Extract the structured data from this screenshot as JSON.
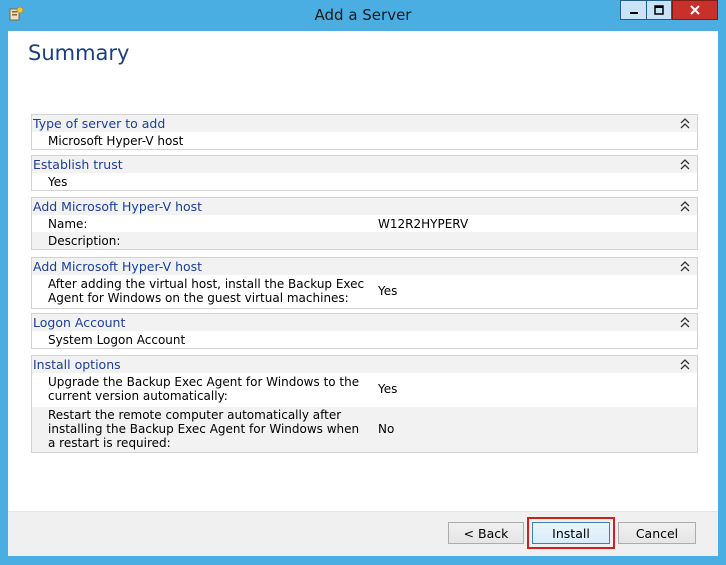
{
  "window": {
    "title": "Add a Server"
  },
  "page": {
    "heading": "Summary"
  },
  "sections": [
    {
      "title": "Type of server to add",
      "rows": [
        {
          "key": "Microsoft Hyper-V host",
          "value": ""
        }
      ]
    },
    {
      "title": "Establish trust",
      "rows": [
        {
          "key": "Yes",
          "value": ""
        }
      ]
    },
    {
      "title": "Add Microsoft Hyper-V host",
      "rows": [
        {
          "key": "Name:",
          "value": "W12R2HYPERV"
        },
        {
          "key": "Description:",
          "value": ""
        }
      ]
    },
    {
      "title": "Add Microsoft Hyper-V host",
      "rows": [
        {
          "key_lines": [
            "After adding the virtual host, install the Backup Exec",
            "Agent for Windows on the guest virtual machines:"
          ],
          "value": "Yes"
        }
      ]
    },
    {
      "title": "Logon Account",
      "rows": [
        {
          "key": "System Logon Account",
          "value": ""
        }
      ]
    },
    {
      "title": "Install options",
      "rows": [
        {
          "key_lines": [
            "Upgrade the Backup Exec Agent for Windows to the",
            "current version automatically:"
          ],
          "value": "Yes"
        },
        {
          "key_lines": [
            "Restart the remote computer automatically after",
            "installing the Backup Exec Agent for Windows when",
            "a restart is required:"
          ],
          "value": "No"
        }
      ]
    }
  ],
  "buttons": {
    "back": "< Back",
    "install": "Install",
    "cancel": "Cancel"
  },
  "icons": {
    "collapse": "double-chevron-up-icon",
    "minimize": "minimize-icon",
    "maximize": "maximize-icon",
    "close": "close-icon"
  },
  "colors": {
    "chrome": "#4aaee3",
    "section_title": "#1a3f96",
    "heading": "#1e3f7a",
    "close_button": "#c7312a",
    "highlight": "#d01f1f"
  }
}
